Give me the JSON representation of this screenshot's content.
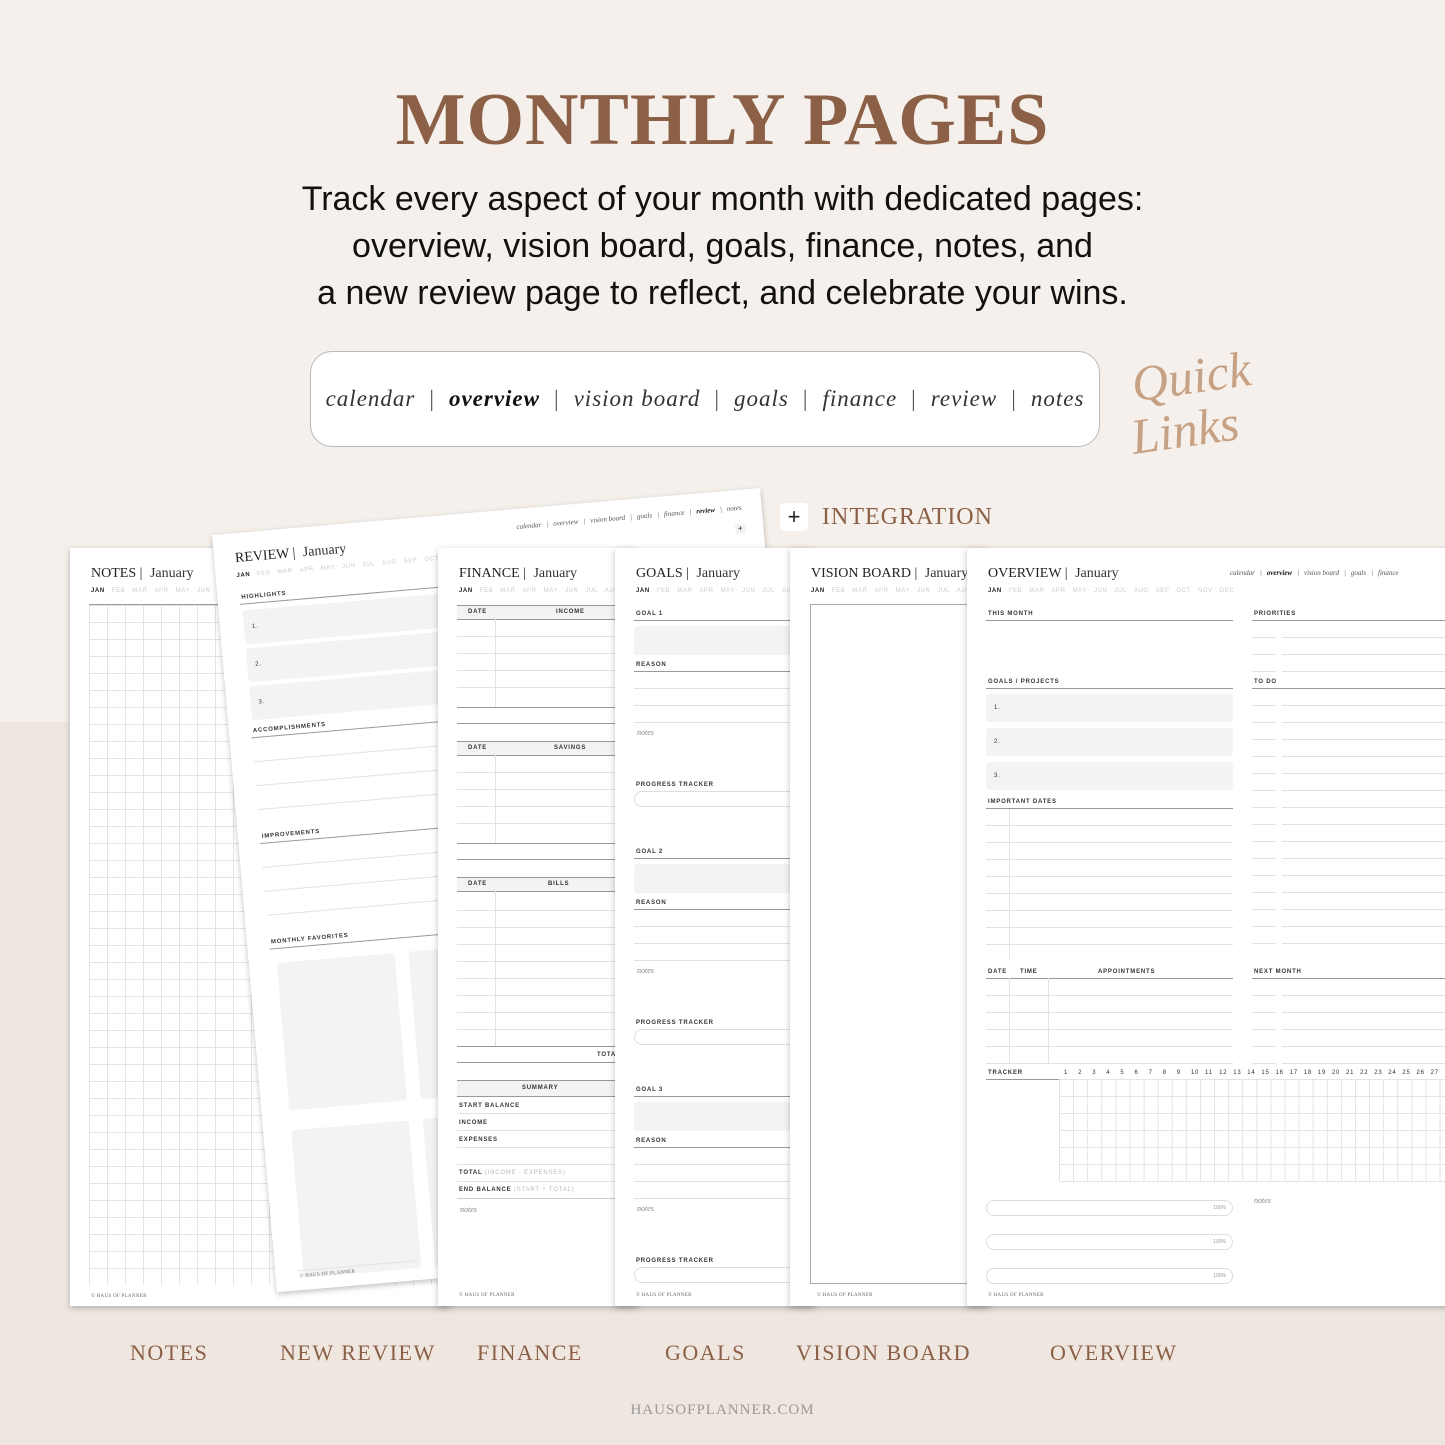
{
  "header": {
    "title": "MONTHLY PAGES",
    "subtitle_lines": [
      "Track every aspect of your month with dedicated pages:",
      "overview, vision board, goals, finance, notes, and",
      "a new review page to reflect, and celebrate your wins."
    ]
  },
  "quick_links": {
    "items": [
      "calendar",
      "overview",
      "vision board",
      "goals",
      "finance",
      "review",
      "notes"
    ],
    "active": "overview",
    "script_label": [
      "Quick",
      "Links"
    ]
  },
  "integration": {
    "icon": "plus-icon",
    "label": "INTEGRATION"
  },
  "months": [
    "JAN",
    "FEB",
    "MAR",
    "APR",
    "MAY",
    "JUN",
    "JUL",
    "AUG",
    "SEP",
    "OCT",
    "NOV",
    "DEC"
  ],
  "month_name": "January",
  "footer": "© HAUS OF PLANNER",
  "pages": {
    "notes": {
      "title": "NOTES"
    },
    "review": {
      "title": "REVIEW",
      "highlights": "HIGHLIGHTS",
      "nums": [
        "1.",
        "2.",
        "3."
      ],
      "accomplishments": "ACCOMPLISHMENTS",
      "improvements": "IMPROVEMENTS",
      "favorites": "MONTHLY FAVORITES",
      "nav": [
        "calendar",
        "overview",
        "vision board",
        "goals",
        "finance",
        "review",
        "notes"
      ],
      "plus": "+"
    },
    "finance": {
      "title": "FINANCE",
      "date": "DATE",
      "income": "INCOME",
      "savings": "SAVINGS",
      "bills": "BILLS",
      "total": "TOTAL",
      "summary": "SUMMARY",
      "start_balance": "START BALANCE",
      "income_row": "INCOME",
      "expenses": "EXPENSES",
      "total_row": "TOTAL",
      "total_hint": "(INCOME - EXPENSES)",
      "end_balance": "END BALANCE",
      "end_hint": "(START + TOTAL)",
      "notes": "notes"
    },
    "goals": {
      "title": "GOALS",
      "goal_labels": [
        "GOAL 1",
        "GOAL 2",
        "GOAL 3"
      ],
      "reason": "REASON",
      "notes": "notes",
      "progress": "PROGRESS TRACKER"
    },
    "vision": {
      "title": "VISION BOARD"
    },
    "overview": {
      "title": "OVERVIEW",
      "nav": [
        "calendar",
        "overview",
        "vision board",
        "goals",
        "finance"
      ],
      "this_month": "THIS MONTH",
      "goals_projects": "GOALS / PROJECTS",
      "nums": [
        "1.",
        "2.",
        "3."
      ],
      "important_dates": "IMPORTANT DATES",
      "date": "DATE",
      "time": "TIME",
      "appointments": "APPOINTMENTS",
      "tracker": "TRACKER",
      "days": [
        "1",
        "2",
        "3",
        "4",
        "5",
        "6",
        "7",
        "8",
        "9",
        "10",
        "11",
        "12",
        "13",
        "14",
        "15",
        "16",
        "17",
        "18",
        "19",
        "20",
        "21",
        "22",
        "23",
        "24",
        "25",
        "26",
        "27"
      ],
      "priorities": "PRIORITIES",
      "todo": "TO DO",
      "next_month": "NEXT MONTH",
      "notes": "notes",
      "pill_value": "100%"
    }
  },
  "captions": [
    "NOTES",
    "NEW REVIEW",
    "FINANCE",
    "GOALS",
    "VISION BOARD",
    "OVERVIEW"
  ],
  "site": "HAUSOFPLANNER.COM",
  "colors": {
    "accent": "#8b6047",
    "script": "#c7a184",
    "bg_top": "#f5f0eb",
    "bg_bottom": "#efe6e0"
  }
}
